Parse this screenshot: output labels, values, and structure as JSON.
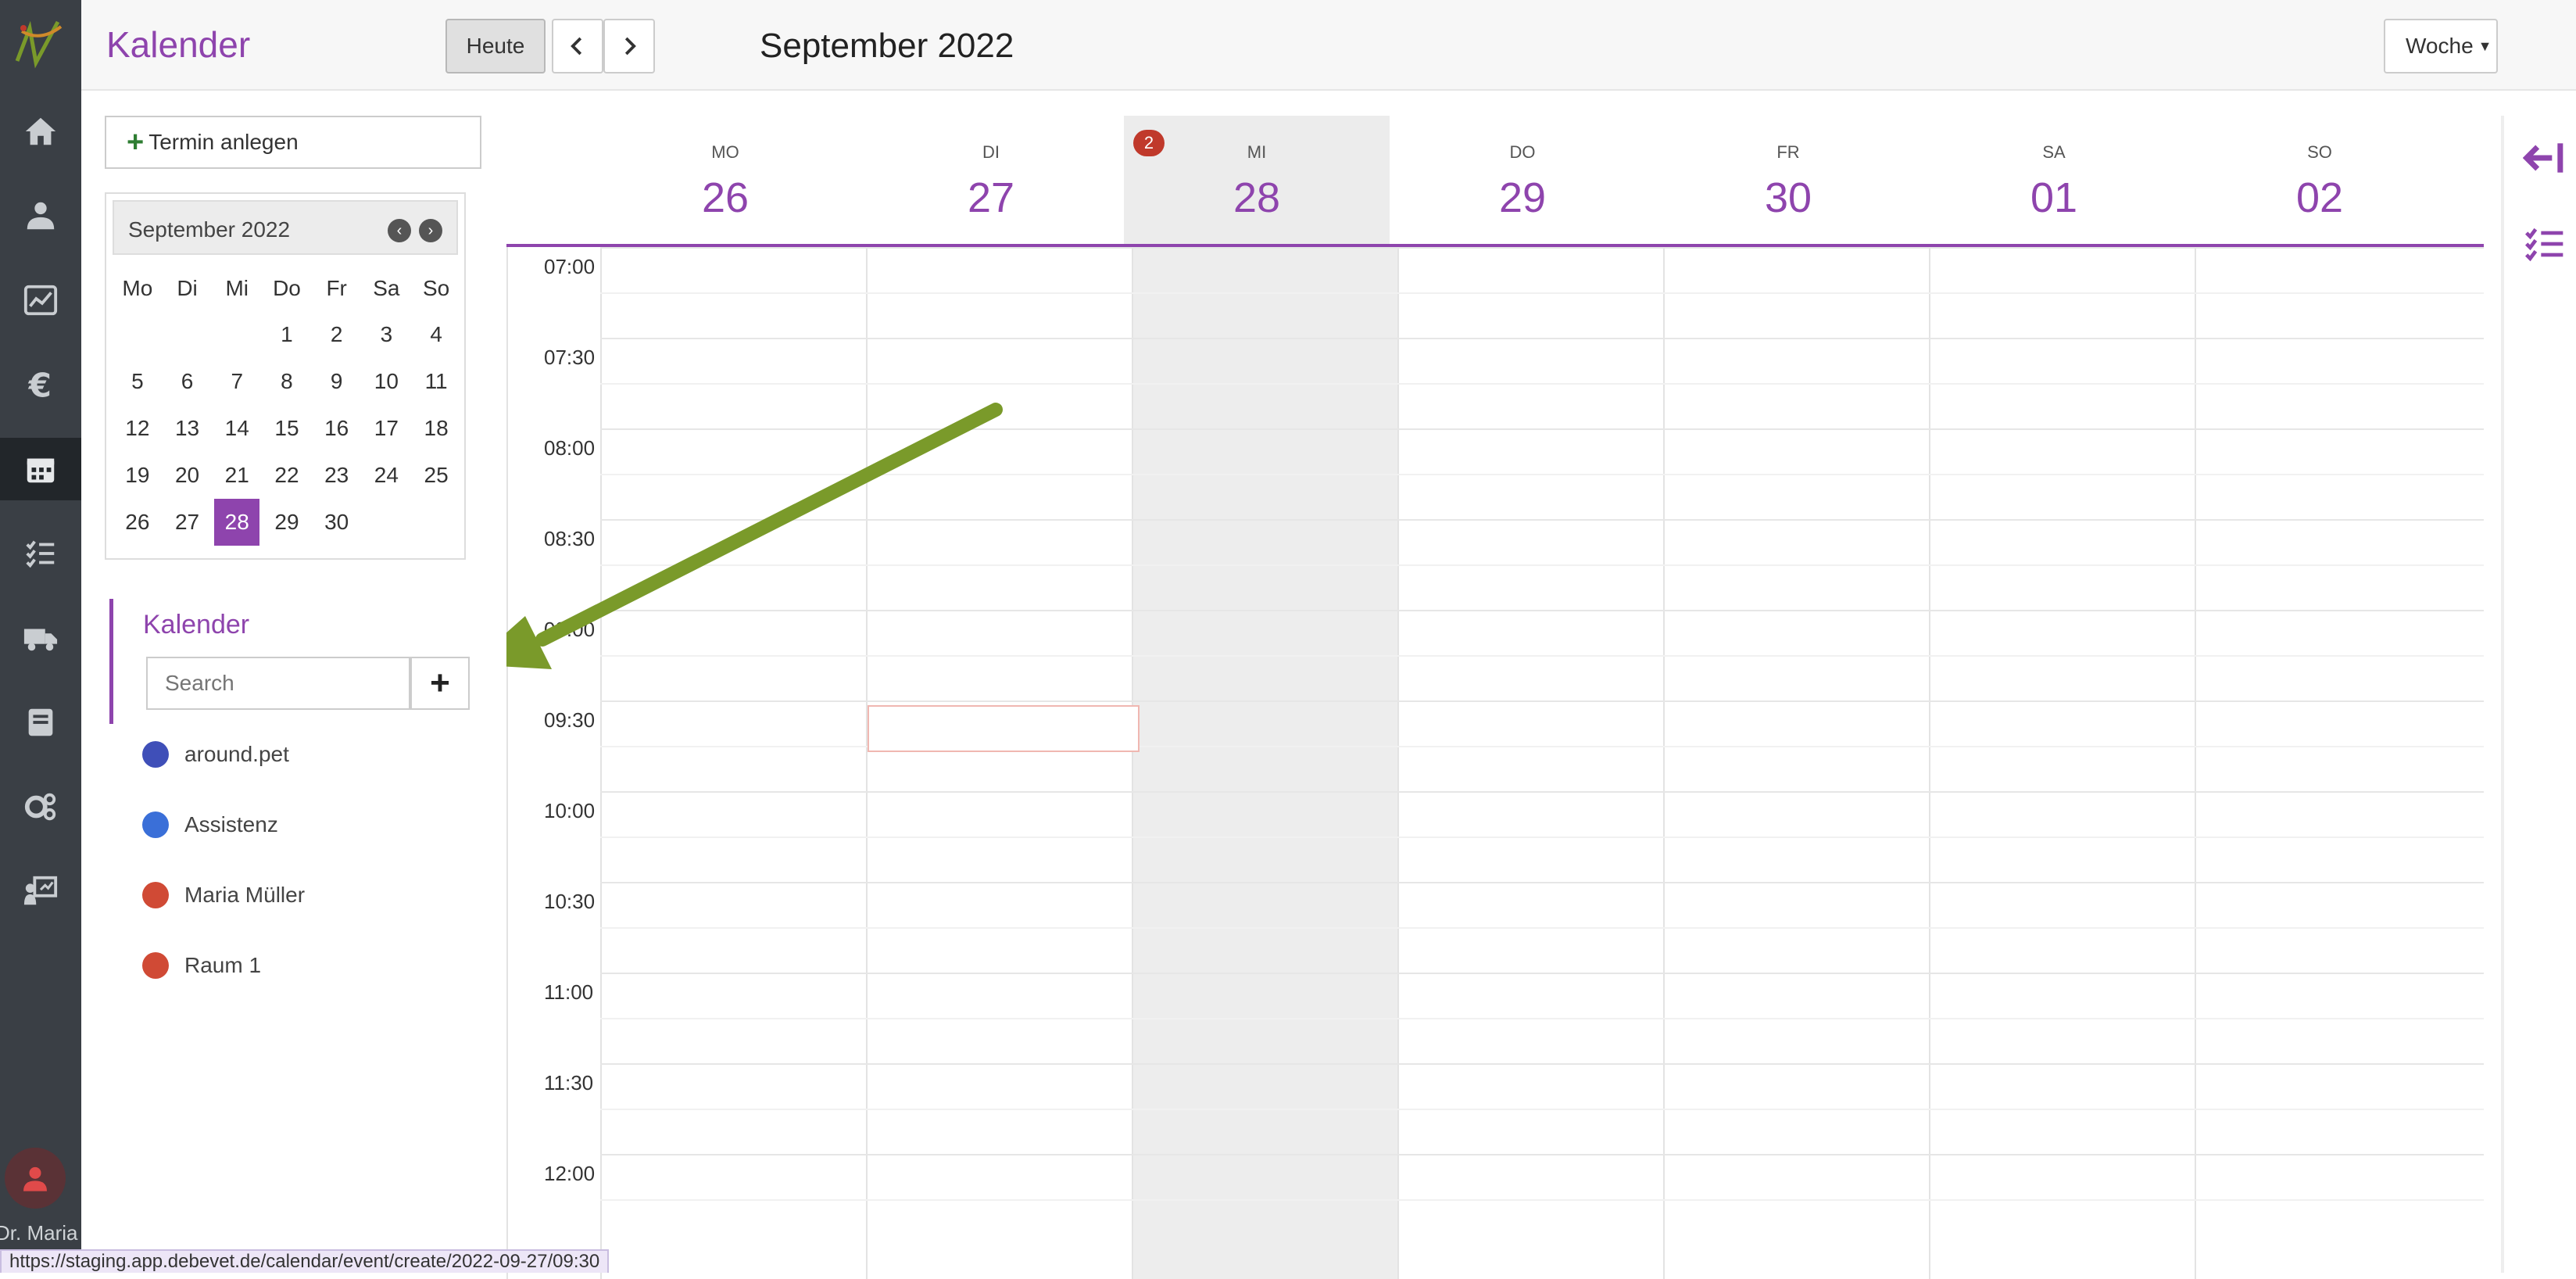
{
  "app": {
    "title": "Kalender",
    "user_name": "Dr. Maria"
  },
  "header": {
    "today_label": "Heute",
    "prev_label": "<",
    "next_label": ">",
    "month_label": "September 2022",
    "view_label": "Woche"
  },
  "sidebar_rail": {
    "items": [
      {
        "icon": "home-icon"
      },
      {
        "icon": "user-doctor-icon"
      },
      {
        "icon": "chart-icon"
      },
      {
        "icon": "euro-icon"
      },
      {
        "icon": "calendar-icon",
        "active": true
      },
      {
        "icon": "task-list-icon"
      },
      {
        "icon": "truck-icon"
      },
      {
        "icon": "book-icon"
      },
      {
        "icon": "settings-icon"
      },
      {
        "icon": "presentation-icon"
      }
    ]
  },
  "left_panel": {
    "new_event_label": "Termin anlegen",
    "mini_cal": {
      "title": "September 2022",
      "weekdays": [
        "Mo",
        "Di",
        "Mi",
        "Do",
        "Fr",
        "Sa",
        "So"
      ],
      "weeks": [
        [
          "",
          "",
          "",
          "1",
          "2",
          "3",
          "4"
        ],
        [
          "5",
          "6",
          "7",
          "8",
          "9",
          "10",
          "11"
        ],
        [
          "12",
          "13",
          "14",
          "15",
          "16",
          "17",
          "18"
        ],
        [
          "19",
          "20",
          "21",
          "22",
          "23",
          "24",
          "25"
        ],
        [
          "26",
          "27",
          "28",
          "29",
          "30",
          "",
          ""
        ]
      ],
      "selected_day": "28"
    },
    "calendars_title": "Kalender",
    "search_placeholder": "Search",
    "add_label": "+",
    "calendars": [
      {
        "name": "around.pet",
        "color": "#3f4fb8"
      },
      {
        "name": "Assistenz",
        "color": "#3a6fd8"
      },
      {
        "name": "Maria Müller",
        "color": "#d04a35"
      },
      {
        "name": "Raum 1",
        "color": "#d04a35"
      }
    ]
  },
  "week": {
    "days": [
      {
        "name": "MO",
        "num": "26"
      },
      {
        "name": "DI",
        "num": "27"
      },
      {
        "name": "MI",
        "num": "28",
        "today": true,
        "badge": "2"
      },
      {
        "name": "DO",
        "num": "29"
      },
      {
        "name": "FR",
        "num": "30"
      },
      {
        "name": "SA",
        "num": "01"
      },
      {
        "name": "SO",
        "num": "02"
      }
    ],
    "times": [
      "07:00",
      "07:30",
      "08:00",
      "08:30",
      "09:00",
      "09:30",
      "10:00",
      "10:30",
      "11:00",
      "11:30",
      "12:00"
    ]
  },
  "status_url": "https://staging.app.debevet.de/calendar/event/create/2022-09-27/09:30",
  "colors": {
    "accent": "#8e44ad",
    "rail": "#3a3f45",
    "arrow": "#7a9a2a"
  }
}
